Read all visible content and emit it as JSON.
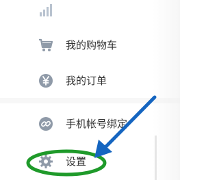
{
  "menu": {
    "items": [
      {
        "id": "blurred",
        "label": "",
        "icon": "signal-bars-icon"
      },
      {
        "id": "cart",
        "label": "我的购物车",
        "icon": "shopping-cart-icon"
      },
      {
        "id": "orders",
        "label": "我的订单",
        "icon": "yen-circle-icon"
      },
      {
        "id": "bind",
        "label": "手机帐号绑定",
        "icon": "link-icon"
      },
      {
        "id": "settings",
        "label": "设置",
        "icon": "gear-icon"
      }
    ]
  },
  "colors": {
    "icon": "#8f9aa8",
    "text": "#333333",
    "highlight_ellipse": "#1f9a2a",
    "arrow": "#1565c0"
  }
}
